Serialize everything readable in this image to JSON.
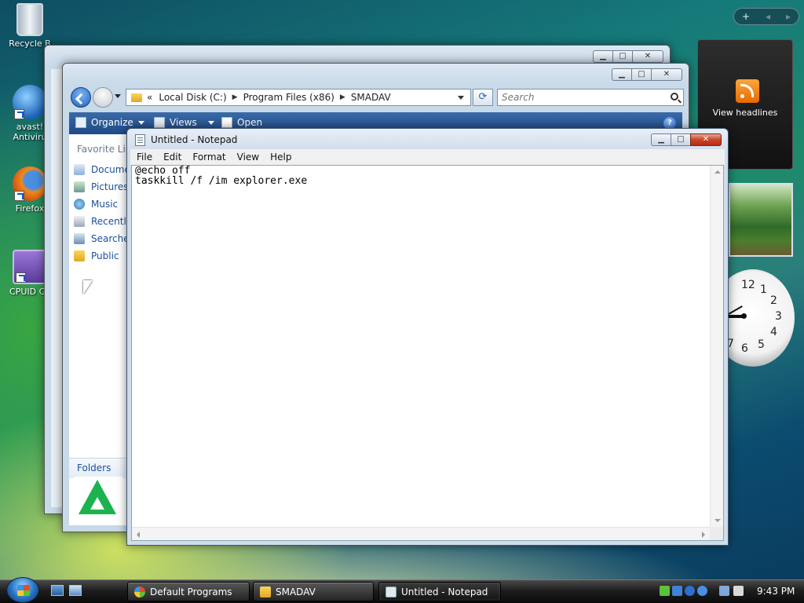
{
  "desktop": {
    "icons": [
      {
        "label": "Recycle B",
        "icon": "recycle-bin-icon"
      },
      {
        "label": "avast! Antiviru",
        "icon": "avast-icon"
      },
      {
        "label": "Firefox",
        "icon": "firefox-icon"
      },
      {
        "label": "CPUID CP",
        "icon": "cpuid-icon"
      }
    ]
  },
  "sidebar": {
    "controls": [
      "+",
      "◂",
      "▸"
    ],
    "feed_label": "View headlines",
    "clock_numbers": [
      "12",
      "1",
      "2",
      "3",
      "4",
      "5",
      "6",
      "7"
    ]
  },
  "explorer": {
    "address": [
      "«",
      "Local Disk (C:)",
      "Program Files (x86)",
      "SMADAV"
    ],
    "search_placeholder": "Search",
    "toolbar": {
      "organize": "Organize",
      "views": "Views",
      "open": "Open"
    },
    "favorite_title": "Favorite Lin",
    "nav_links": [
      "Docume",
      "Pictures",
      "Music",
      "Recently",
      "Searches",
      "Public"
    ],
    "folders_label": "Folders"
  },
  "notepad": {
    "title": "Untitled - Notepad",
    "menu": [
      "File",
      "Edit",
      "Format",
      "View",
      "Help"
    ],
    "content": "@echo off\ntaskkill /f /im explorer.exe"
  },
  "taskbar": {
    "buttons": [
      {
        "label": "Default Programs",
        "icon": "default-programs-icon"
      },
      {
        "label": "SMADAV",
        "icon": "folder-icon"
      },
      {
        "label": "Untitled - Notepad",
        "icon": "notepad-icon"
      }
    ],
    "time": "9:43 PM"
  },
  "colors": {
    "accent": "#1f4b86",
    "link": "#1b4f9e",
    "smadav_green": "#1bb24f"
  }
}
